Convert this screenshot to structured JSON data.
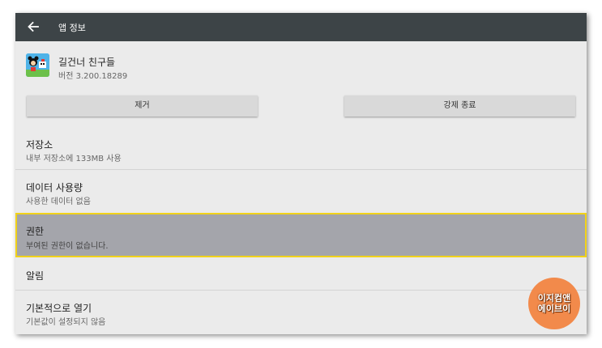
{
  "appbar": {
    "title": "앱 정보"
  },
  "app": {
    "name": "길건너 친구들",
    "version": "버전 3.200.18289"
  },
  "buttons": {
    "remove": "제거",
    "force_stop": "강제 종료"
  },
  "rows": [
    {
      "title": "저장소",
      "subtitle": "내부 저장소에 133MB 사용"
    },
    {
      "title": "데이터 사용량",
      "subtitle": "사용한 데이터 없음"
    },
    {
      "title": "권한",
      "subtitle": "부여된 권한이 없습니다."
    },
    {
      "title": "알림",
      "subtitle": ""
    },
    {
      "title": "기본적으로 열기",
      "subtitle": "기본값이 설정되지 않음"
    }
  ],
  "watermark": {
    "line1": "이지컴앤",
    "line2": "에이브이"
  },
  "icons": {
    "back": "arrow-left-icon",
    "app": "app-icon"
  },
  "colors": {
    "appbar": "#3d4447",
    "highlight": "#a4a5ab",
    "highlight_border": "#f1d21a",
    "badge": "#f28a4b"
  }
}
